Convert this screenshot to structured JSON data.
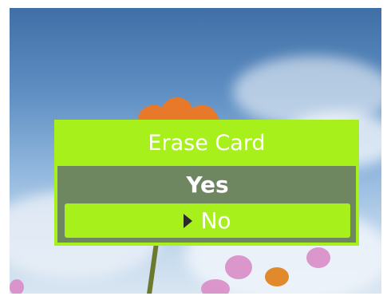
{
  "dialog": {
    "title": "Erase Card",
    "options": [
      {
        "label": "Yes",
        "selected": false
      },
      {
        "label": "No",
        "selected": true
      }
    ]
  },
  "colors": {
    "dialog_background": "#a7f01c",
    "options_panel": "#5f6973",
    "text": "#ffffff",
    "selection_arrow": "#2a2a2a"
  },
  "icons": {
    "selection_arrow": "caret-right-icon"
  }
}
